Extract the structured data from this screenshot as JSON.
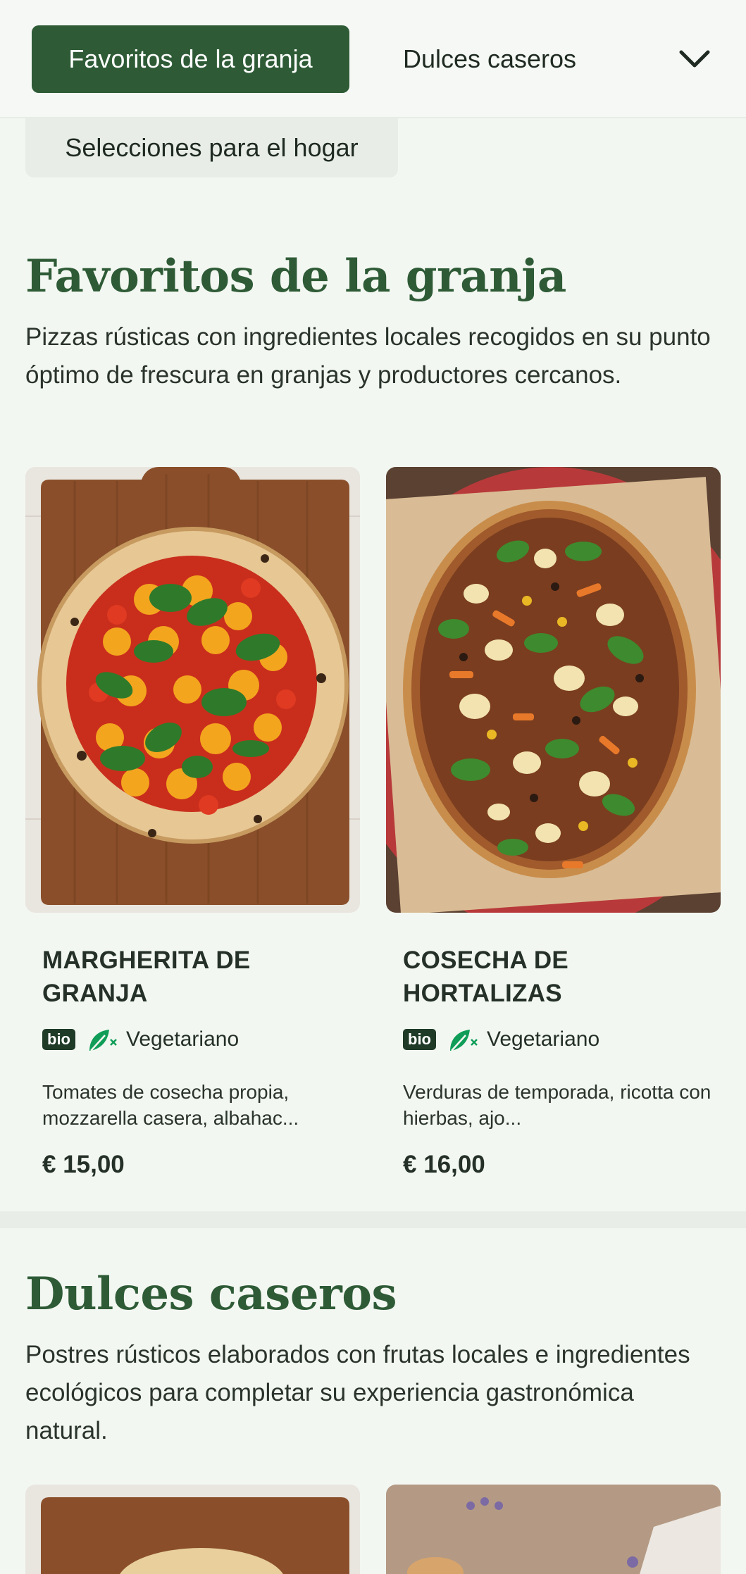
{
  "tabs": {
    "active": "Favoritos de la granja",
    "second": "Dulces caseros",
    "wrapped": "Selecciones para el hogar"
  },
  "sections": [
    {
      "title": "Favoritos de la granja",
      "description": "Pizzas rústicas con ingredientes locales recogidos en su punto óptimo de frescura en granjas y productores cercanos.",
      "items": [
        {
          "name": "MARGHERITA DE GRANJA",
          "badge": "bio",
          "diet_icon": "vegetarian-leaf-icon",
          "diet": "Vegetariano",
          "description": "Tomates de cosecha propia, mozzarella casera, albahac...",
          "price": "€ 15,00"
        },
        {
          "name": "COSECHA DE HORTALIZAS",
          "badge": "bio",
          "diet_icon": "vegetarian-leaf-icon",
          "diet": "Vegetariano",
          "description": "Verduras de temporada, ricotta con hierbas, ajo...",
          "price": "€ 16,00"
        }
      ]
    },
    {
      "title": "Dulces caseros",
      "description": "Postres rústicos elaborados con frutas locales e ingredientes ecológicos para completar su experiencia gastronómica natural."
    }
  ],
  "colors": {
    "brand_green": "#2e5b36",
    "page_bg": "#f3f7f2",
    "veg_icon": "#0f9d58"
  }
}
